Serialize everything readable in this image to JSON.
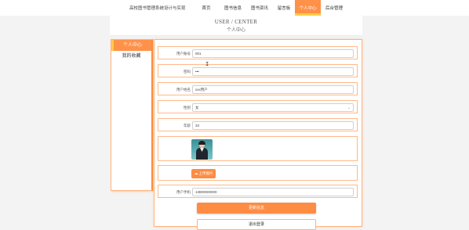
{
  "header": {
    "site_title": "高校图书管理系统设计与实现",
    "nav": [
      {
        "label": "首页",
        "active": false
      },
      {
        "label": "图书信息",
        "active": false
      },
      {
        "label": "图书资讯",
        "active": false
      },
      {
        "label": "留言板",
        "active": false
      },
      {
        "label": "个人中心",
        "active": true
      },
      {
        "label": "后台管理",
        "active": false
      }
    ]
  },
  "banner": {
    "en": "USER / CENTER",
    "cn": "个人中心"
  },
  "sidebar": {
    "items": [
      {
        "label": "个人中心",
        "active": true
      },
      {
        "label": "我的收藏",
        "active": false
      }
    ]
  },
  "form": {
    "account": {
      "label": "用户账号",
      "value": "001"
    },
    "password": {
      "label": "密码",
      "value": "•••"
    },
    "name": {
      "label": "用户姓名",
      "value": "xxx用户"
    },
    "gender": {
      "label": "性别",
      "value": "女"
    },
    "age": {
      "label": "年龄",
      "value": "33"
    },
    "upload_label": "上传图片",
    "phone": {
      "label": "用户手机",
      "value": "13800000000"
    }
  },
  "buttons": {
    "update": "更新信息",
    "logout": "退出登录"
  },
  "colors": {
    "accent": "#ff9149",
    "accent_border": "#ffcb45",
    "button": "#ff8c43"
  }
}
